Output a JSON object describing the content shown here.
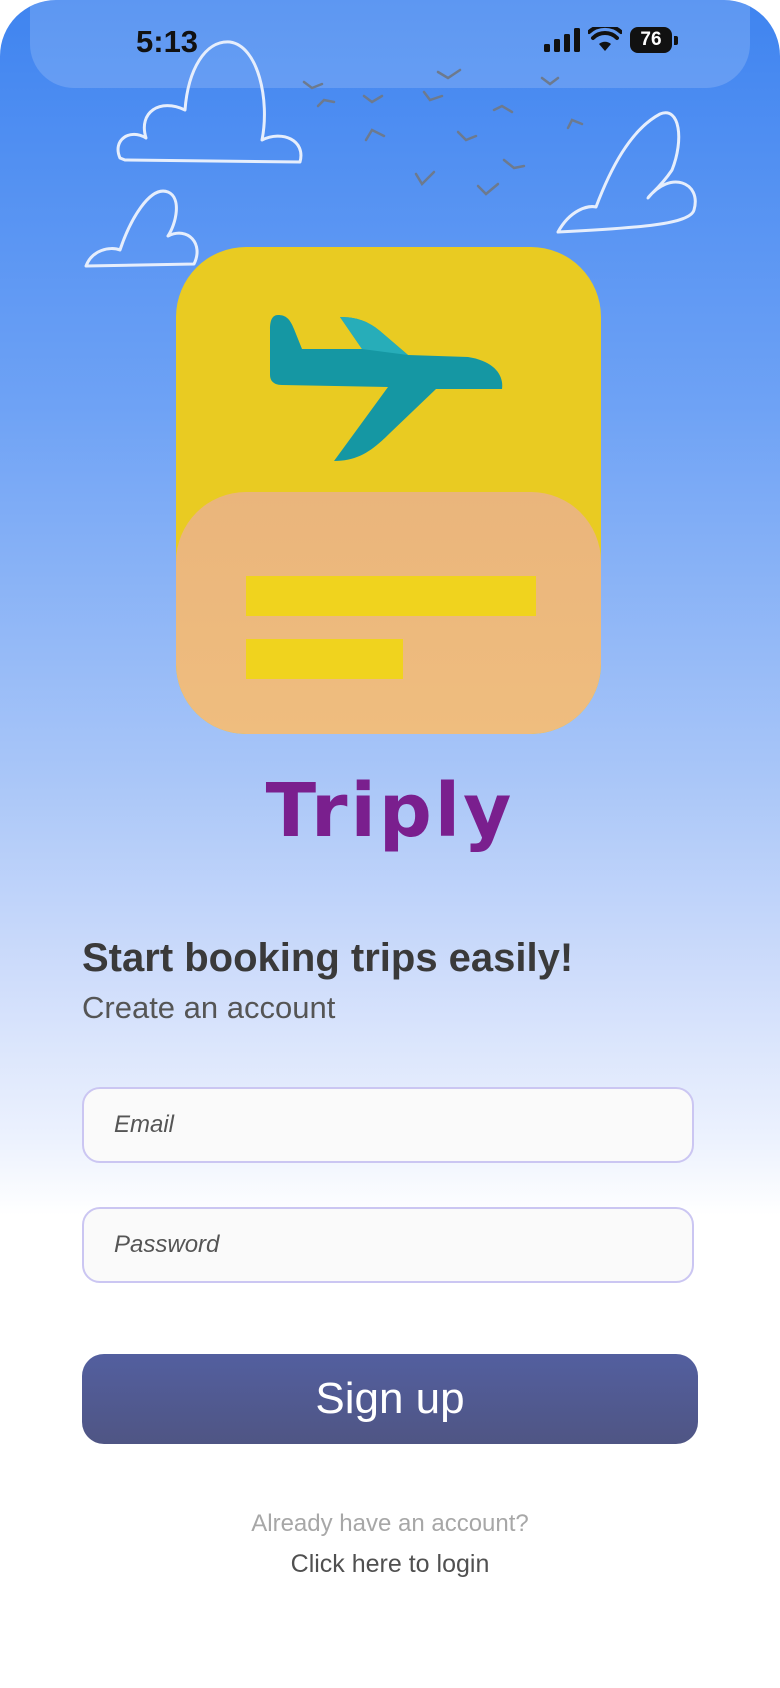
{
  "status_bar": {
    "time": "5:13",
    "battery": "76",
    "icons": [
      "cellular-signal-icon",
      "wifi-icon",
      "battery-icon"
    ]
  },
  "decorations": [
    "cloud-icon",
    "bird-flock-icon",
    "airplane-icon"
  ],
  "app": {
    "name": "Triply"
  },
  "signup": {
    "headline": "Start booking trips easily!",
    "subheadline": "Create an account",
    "email_placeholder": "Email",
    "password_placeholder": "Password",
    "button_label": "Sign up",
    "already_text": "Already have an account?",
    "login_link": "Click here to login"
  },
  "colors": {
    "brand_purple": "#7a1f8e",
    "button": "#515a93",
    "sky_top": "#3f84f0",
    "logo_yellow": "#e9cb22",
    "logo_peach": "#eab57c",
    "plane_teal": "#1597a3"
  }
}
